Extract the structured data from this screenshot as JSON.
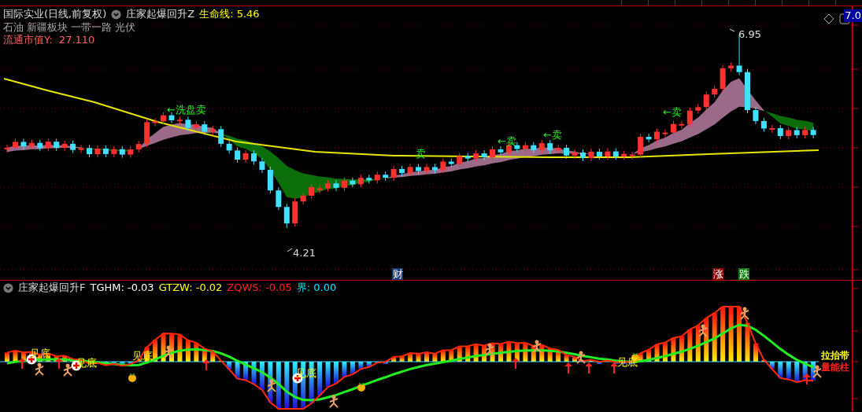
{
  "header": {
    "title": "国际实业(日线,前复权)",
    "indicator": "庄家起爆回升Z",
    "lifeline": "生命线: 5.46",
    "sectors": "石油 新疆板块 一带一路 光伏",
    "float_cap": "流通市值Y:  27.110"
  },
  "price_axis": {
    "top_label": "7.0"
  },
  "main_chart": {
    "high_label": "6.95",
    "low_label": "4.21",
    "signals": [
      {
        "text": "←洗盘卖"
      },
      {
        "text": "卖"
      },
      {
        "text": "←卖"
      },
      {
        "text": "←卖"
      },
      {
        "text": "←卖"
      }
    ],
    "markers": [
      {
        "text": "财",
        "kind": "finance"
      },
      {
        "text": "涨",
        "kind": "up"
      },
      {
        "text": "跌",
        "kind": "down"
      }
    ]
  },
  "sub_chart": {
    "title": "庄家起爆回升F",
    "values": [
      {
        "text": "TGHM: -0.03",
        "color": "#ffffff"
      },
      {
        "text": "GTZW: -0.02",
        "color": "#ffff00"
      },
      {
        "text": "ZQWS: -0.05",
        "color": "#ff2020"
      },
      {
        "text": "界: 0.00",
        "color": "#00e5ff"
      }
    ],
    "bottom_labels": [
      "见底",
      "见底",
      "见底",
      "见底",
      "见底"
    ],
    "legend": [
      {
        "text": "拉抬带",
        "color": "#ffff00"
      },
      {
        "text": "量能柱",
        "color": "#ff2020"
      }
    ]
  }
}
